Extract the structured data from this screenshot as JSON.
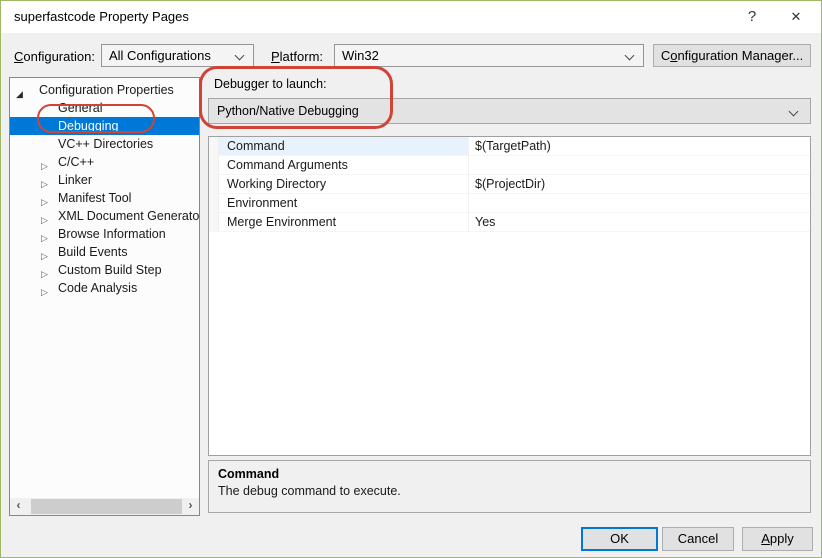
{
  "colors": {
    "accent_blue": "#0078d7",
    "annotation_red": "#d04437",
    "window_border_green": "#9eb868"
  },
  "titlebar": {
    "title": "superfastcode Property Pages",
    "help_glyph": "?",
    "close_glyph": "✕"
  },
  "toolbar": {
    "configuration_label": {
      "mnemonic": "C",
      "rest": "onfiguration:"
    },
    "configuration_value": "All Configurations",
    "platform_label": {
      "mnemonic": "P",
      "rest": "latform:"
    },
    "platform_value": "Win32",
    "config_manager_button": {
      "pre": "C",
      "mnemonic": "o",
      "rest": "nfiguration Manager..."
    }
  },
  "tree": {
    "root": {
      "label": "Configuration Properties",
      "expander": "◢"
    },
    "collapsed_expander": "▷",
    "items": [
      {
        "label": "General",
        "expandable": false,
        "selected": false
      },
      {
        "label": "Debugging",
        "expandable": false,
        "selected": true
      },
      {
        "label": "VC++ Directories",
        "expandable": false,
        "selected": false
      },
      {
        "label": "C/C++",
        "expandable": true,
        "selected": false
      },
      {
        "label": "Linker",
        "expandable": true,
        "selected": false
      },
      {
        "label": "Manifest Tool",
        "expandable": true,
        "selected": false
      },
      {
        "label": "XML Document Generator",
        "expandable": true,
        "selected": false
      },
      {
        "label": "Browse Information",
        "expandable": true,
        "selected": false
      },
      {
        "label": "Build Events",
        "expandable": true,
        "selected": false
      },
      {
        "label": "Custom Build Step",
        "expandable": true,
        "selected": false
      },
      {
        "label": "Code Analysis",
        "expandable": true,
        "selected": false
      }
    ],
    "hscrollbar": {
      "left_arrow": "‹",
      "right_arrow": "›"
    }
  },
  "debugger": {
    "label": "Debugger to launch:",
    "value": "Python/Native Debugging"
  },
  "properties": {
    "rows": [
      {
        "name": "Command",
        "value": "$(TargetPath)",
        "selected": true
      },
      {
        "name": "Command Arguments",
        "value": "",
        "selected": false
      },
      {
        "name": "Working Directory",
        "value": "$(ProjectDir)",
        "selected": false
      },
      {
        "name": "Environment",
        "value": "",
        "selected": false
      },
      {
        "name": "Merge Environment",
        "value": "Yes",
        "selected": false
      }
    ]
  },
  "description": {
    "title": "Command",
    "text": "The debug command to execute."
  },
  "buttons": {
    "ok": "OK",
    "cancel": "Cancel",
    "apply": {
      "mnemonic": "A",
      "rest": "pply"
    }
  }
}
